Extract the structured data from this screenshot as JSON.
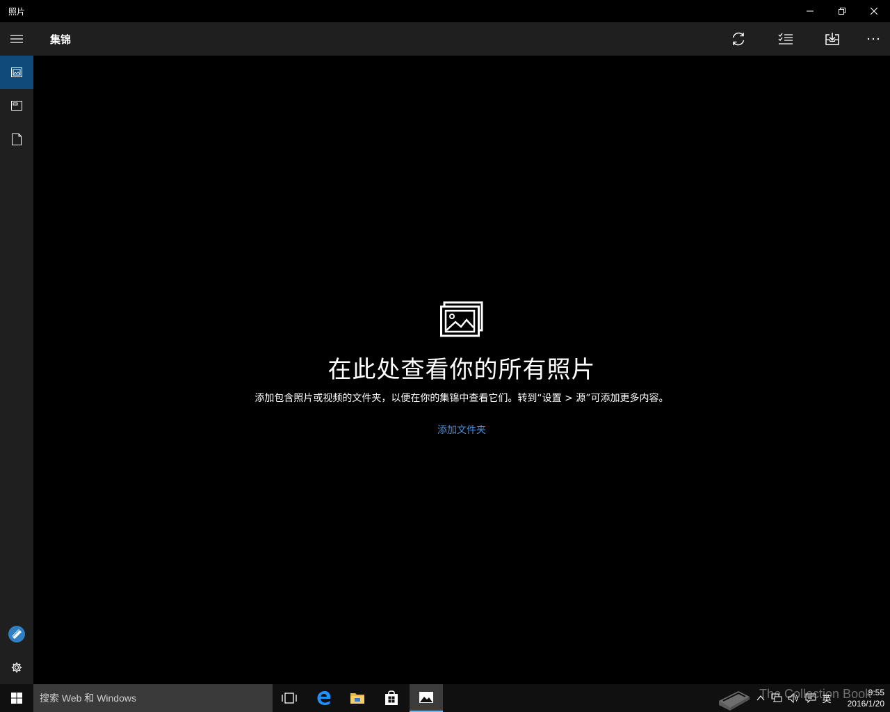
{
  "window": {
    "title": "照片"
  },
  "appbar": {
    "title": "集锦",
    "commands": [
      "refresh-icon",
      "select-icon",
      "import-icon",
      "more-icon"
    ]
  },
  "nav": {
    "items": [
      {
        "name": "collection",
        "icon": "collection-icon",
        "selected": true
      },
      {
        "name": "albums",
        "icon": "albums-icon",
        "selected": false
      },
      {
        "name": "folders",
        "icon": "folder-icon",
        "selected": false
      }
    ],
    "bottom": [
      "feedback-icon",
      "settings-icon"
    ]
  },
  "empty_state": {
    "title": "在此处查看你的所有照片",
    "description": "添加包含照片或视频的文件夹，以便在你的集锦中查看它们。转到“设置 > 源”可添加更多内容。",
    "link": "添加文件夹"
  },
  "taskbar": {
    "search_placeholder": "搜索 Web 和 Windows",
    "ime": "英",
    "time": "9:55",
    "date": "2016/1/20",
    "watermark": "The Collection Book"
  },
  "colors": {
    "accent": "#0f4a7a",
    "link": "#4a90d9",
    "appbar": "#1f1f1f",
    "background": "#000000"
  }
}
